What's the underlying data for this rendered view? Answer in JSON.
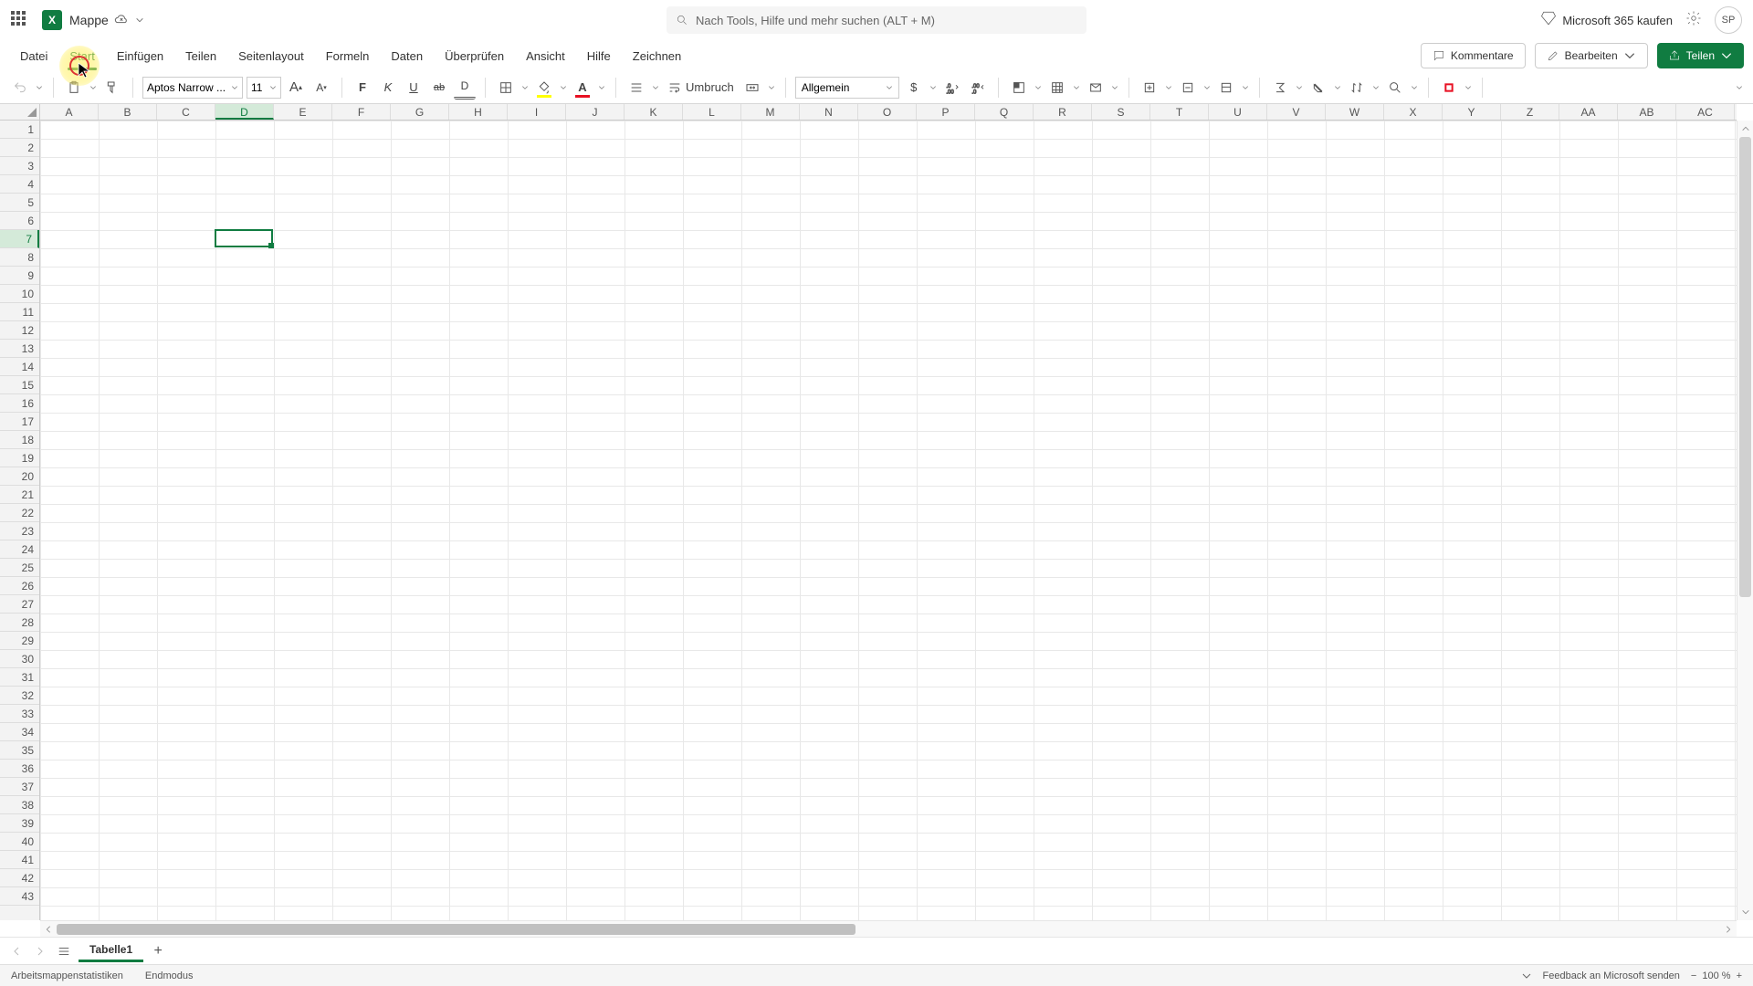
{
  "title": {
    "doc_name": "Mappe"
  },
  "search": {
    "placeholder": "Nach Tools, Hilfe und mehr suchen (ALT + M)"
  },
  "header_right": {
    "buy": "Microsoft 365 kaufen",
    "avatar": "SP"
  },
  "tabs": {
    "items": [
      "Datei",
      "Start",
      "Einfügen",
      "Teilen",
      "Seitenlayout",
      "Formeln",
      "Daten",
      "Überprüfen",
      "Ansicht",
      "Hilfe",
      "Zeichnen"
    ],
    "active_index": 1
  },
  "tab_actions": {
    "comments": "Kommentare",
    "edit": "Bearbeiten",
    "share": "Teilen"
  },
  "toolbar": {
    "font_name": "Aptos Narrow ...",
    "font_size": "11",
    "bold": "F",
    "italic": "K",
    "underline": "U",
    "strike": "ab",
    "dunder": "D",
    "wrap": "Umbruch",
    "number_format": "Allgemein",
    "currency": "$",
    "percent": "%"
  },
  "grid": {
    "columns": [
      "A",
      "B",
      "C",
      "D",
      "E",
      "F",
      "G",
      "H",
      "I",
      "J",
      "K",
      "L",
      "M",
      "N",
      "O",
      "P",
      "Q",
      "R",
      "S",
      "T",
      "U",
      "V",
      "W",
      "X",
      "Y",
      "Z",
      "AA",
      "AB",
      "AC"
    ],
    "rows": 43,
    "selected_col": "D",
    "selected_row": 7
  },
  "sheet": {
    "name": "Tabelle1"
  },
  "status": {
    "stats": "Arbeitsmappenstatistiken",
    "mode": "Endmodus",
    "feedback": "Feedback an Microsoft senden",
    "zoom": "100 %"
  }
}
